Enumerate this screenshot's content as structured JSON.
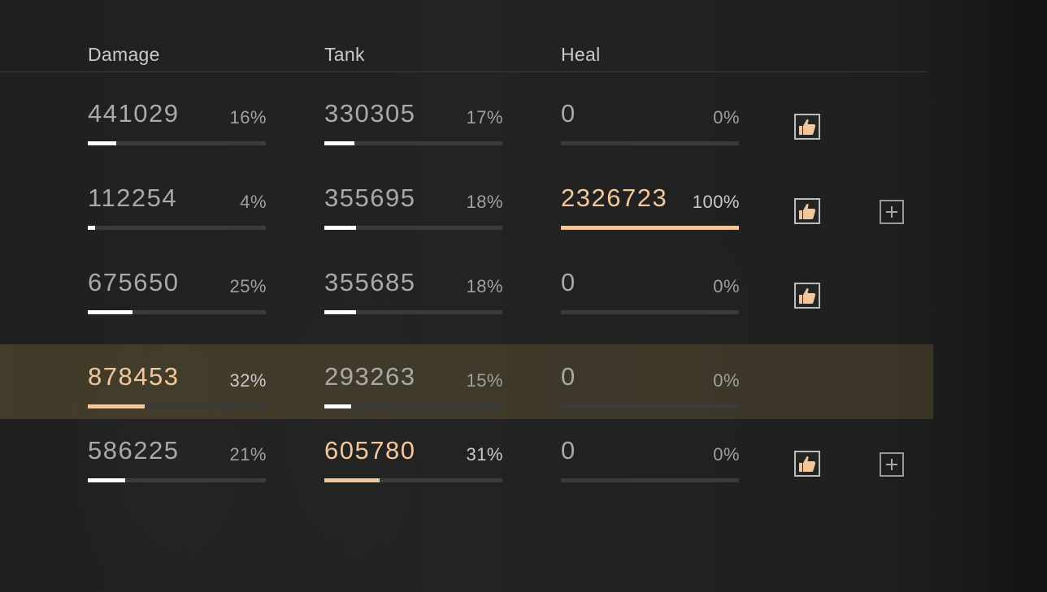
{
  "headers": {
    "damage": "Damage",
    "tank": "Tank",
    "heal": "Heal"
  },
  "colors": {
    "accent": "#f2c79c",
    "bar_default": "#ffffff",
    "bar_track": "#3b3b3b",
    "highlight_row": "#574b31"
  },
  "rows": [
    {
      "damage": {
        "value": "441029",
        "pct": "16%",
        "fraction": 0.16,
        "accent": false
      },
      "tank": {
        "value": "330305",
        "pct": "17%",
        "fraction": 0.17,
        "accent": false
      },
      "heal": {
        "value": "0",
        "pct": "0%",
        "fraction": 0.0,
        "accent": false
      },
      "like_icon": "thumbs-up-icon",
      "add_icon": null,
      "highlight": false
    },
    {
      "damage": {
        "value": "112254",
        "pct": "4%",
        "fraction": 0.04,
        "accent": false
      },
      "tank": {
        "value": "355695",
        "pct": "18%",
        "fraction": 0.18,
        "accent": false
      },
      "heal": {
        "value": "2326723",
        "pct": "100%",
        "fraction": 1.0,
        "accent": true
      },
      "like_icon": "thumbs-up-icon",
      "add_icon": "plus-square-icon",
      "highlight": false
    },
    {
      "damage": {
        "value": "675650",
        "pct": "25%",
        "fraction": 0.25,
        "accent": false
      },
      "tank": {
        "value": "355685",
        "pct": "18%",
        "fraction": 0.18,
        "accent": false
      },
      "heal": {
        "value": "0",
        "pct": "0%",
        "fraction": 0.0,
        "accent": false
      },
      "like_icon": "thumbs-up-icon",
      "add_icon": null,
      "highlight": false
    },
    {
      "damage": {
        "value": "878453",
        "pct": "32%",
        "fraction": 0.32,
        "accent": true
      },
      "tank": {
        "value": "293263",
        "pct": "15%",
        "fraction": 0.15,
        "accent": false
      },
      "heal": {
        "value": "0",
        "pct": "0%",
        "fraction": 0.0,
        "accent": false
      },
      "like_icon": null,
      "add_icon": null,
      "highlight": true
    },
    {
      "damage": {
        "value": "586225",
        "pct": "21%",
        "fraction": 0.21,
        "accent": false
      },
      "tank": {
        "value": "605780",
        "pct": "31%",
        "fraction": 0.31,
        "accent": true
      },
      "heal": {
        "value": "0",
        "pct": "0%",
        "fraction": 0.0,
        "accent": false
      },
      "like_icon": "thumbs-up-icon",
      "add_icon": "plus-square-icon",
      "highlight": false
    }
  ]
}
